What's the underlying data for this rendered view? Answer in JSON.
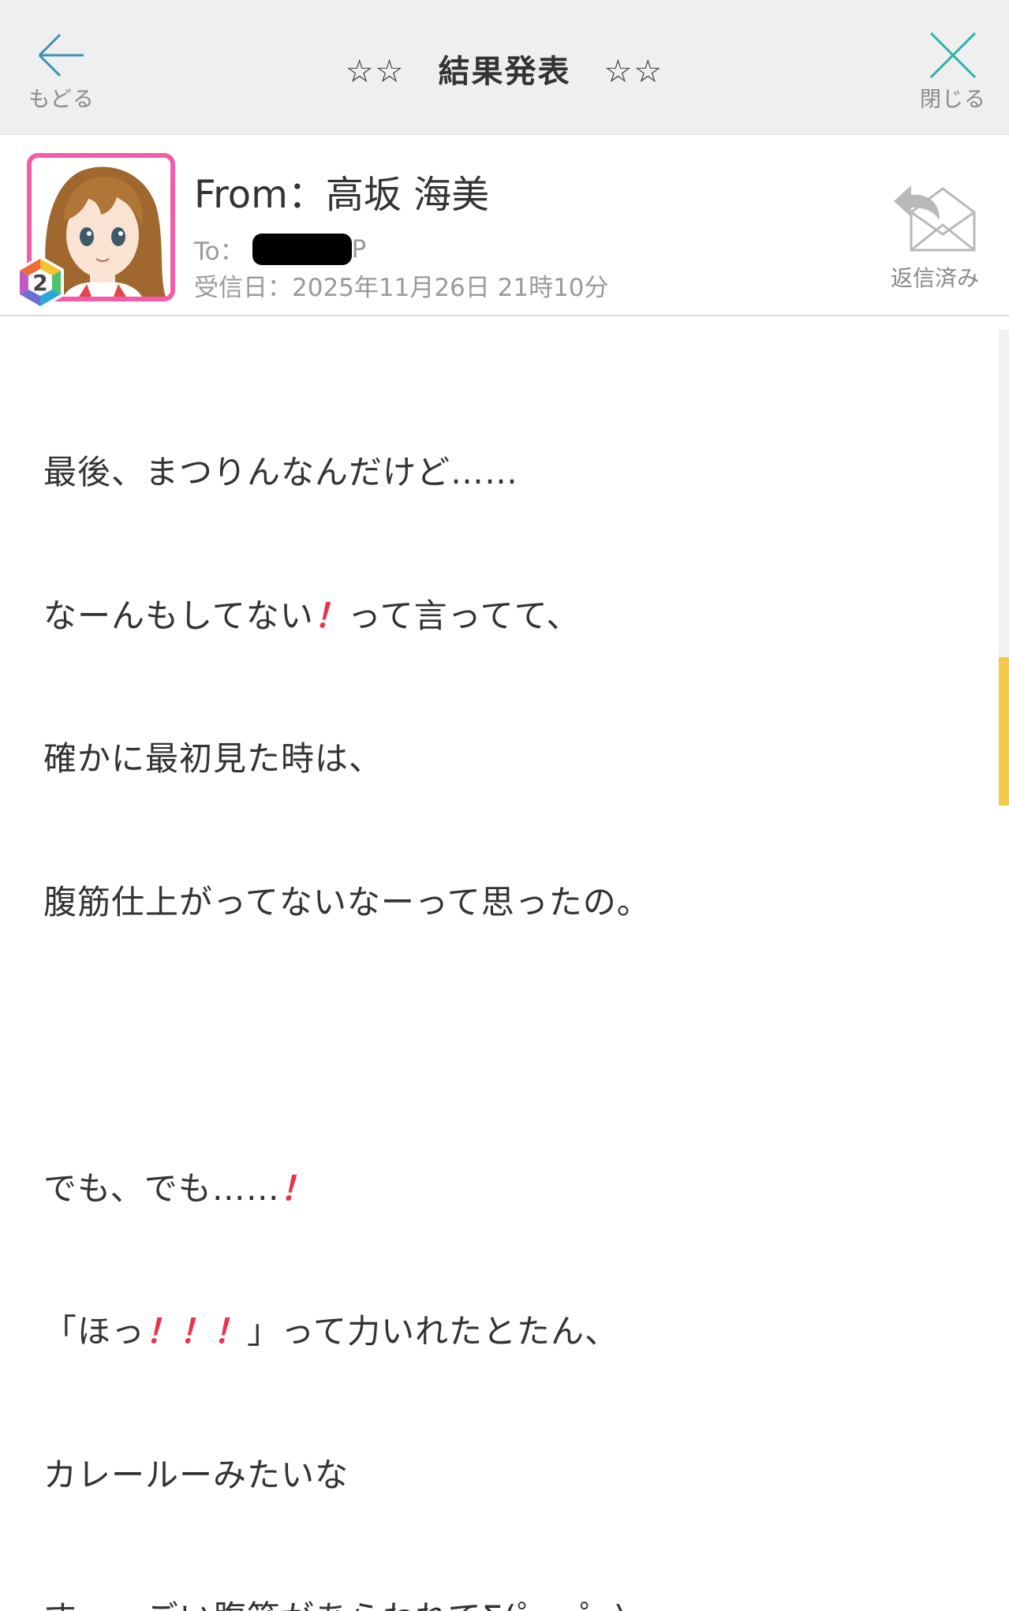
{
  "topbar": {
    "back_label": "もどる",
    "title": "☆☆　結果発表　☆☆",
    "close_label": "閉じる"
  },
  "header": {
    "from_line": "From：高坂 海美",
    "to_prefix": "To：",
    "to_suffix": "P",
    "received": "受信日：2025年11月26日 21時10分",
    "reply_status": "返信済み",
    "badge_text": "2"
  },
  "message": {
    "lines": [
      "最後、まつりんなんだけど……",
      "なーんもしてない",
      "って言ってて、",
      "確かに最初見た時は、",
      "腹筋仕上がってないなーって思ったの。",
      "",
      "でも、でも……",
      "「ほっ",
      "」って力いれたとたん、",
      "カレールーみたいな",
      "すーっごい腹筋があらわれてΣ(゜ω゜)"
    ],
    "exclaim": "！"
  },
  "colors": {
    "accent_cyan": "#3aa7b8",
    "avatar_border": "#f45ca8",
    "exclaim": "#e8344e",
    "scroll_thumb": "#f3c84b"
  }
}
